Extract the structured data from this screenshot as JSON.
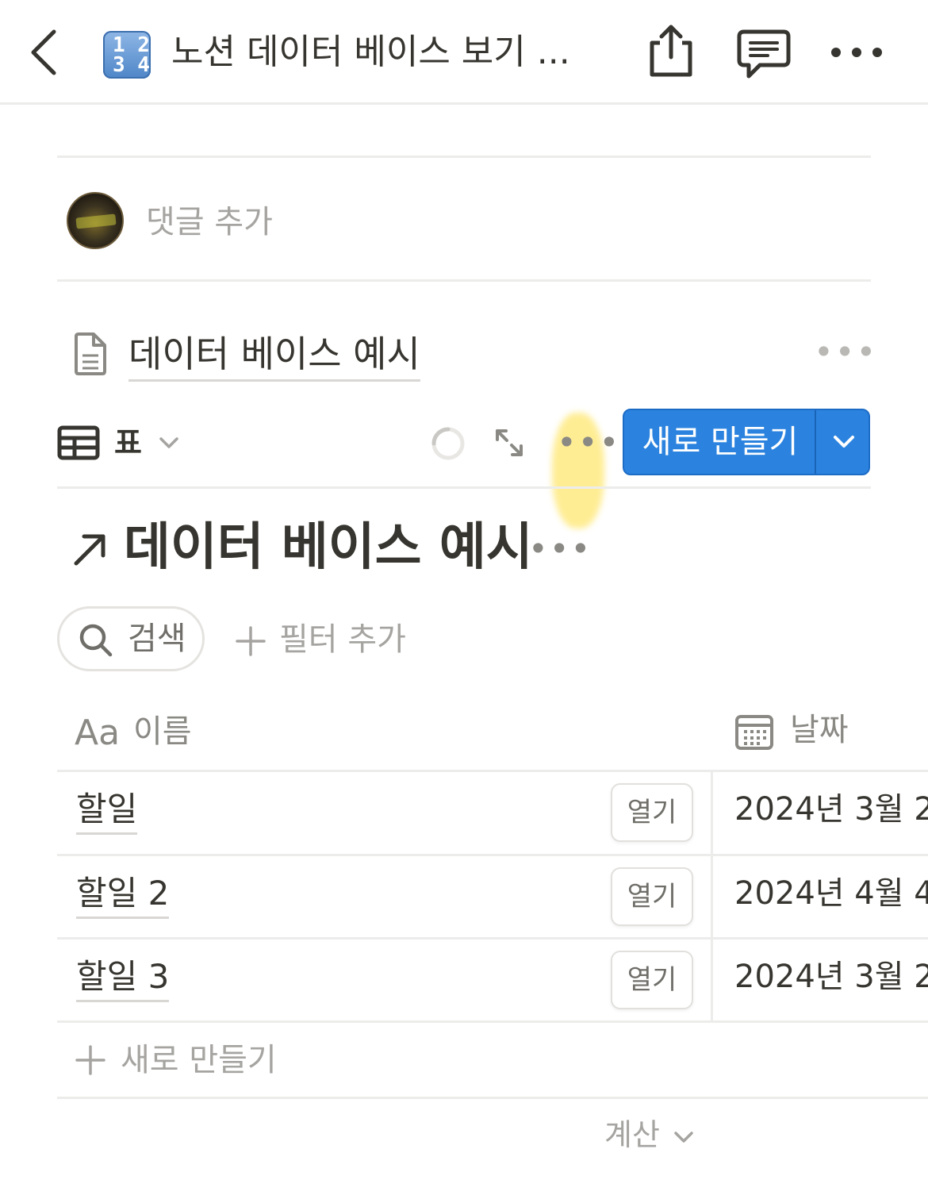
{
  "nav": {
    "title": "노션 데이터 베이스 보기 ...",
    "emoji_top": "1 2",
    "emoji_bottom": "3 4",
    "more": "•••"
  },
  "comment": {
    "placeholder": "댓글 추가"
  },
  "linked_db": {
    "title": "데이터 베이스 예시",
    "more": "•••"
  },
  "toolbar": {
    "view_name": "표",
    "more": "•••",
    "new_button_label": "새로 만들기"
  },
  "database": {
    "title": "데이터 베이스 예시",
    "title_more": "•••",
    "search_label": "검색",
    "add_filter_label": "필터 추가",
    "columns": {
      "name_icon": "Aa",
      "name": "이름",
      "date": "날짜"
    },
    "rows": [
      {
        "title": "할일",
        "open_label": "열기",
        "date": "2024년 3월 2"
      },
      {
        "title": "할일 2",
        "open_label": "열기",
        "date": "2024년 4월 4"
      },
      {
        "title": "할일 3",
        "open_label": "열기",
        "date": "2024년 3월 2"
      }
    ],
    "add_row_label": "새로 만들기",
    "calculate_label": "계산"
  },
  "colors": {
    "accent_blue": "#2b83df",
    "text": "#37352f",
    "muted": "#a5a4a1",
    "divider": "#ececeb",
    "highlight": "#ffde3c"
  }
}
